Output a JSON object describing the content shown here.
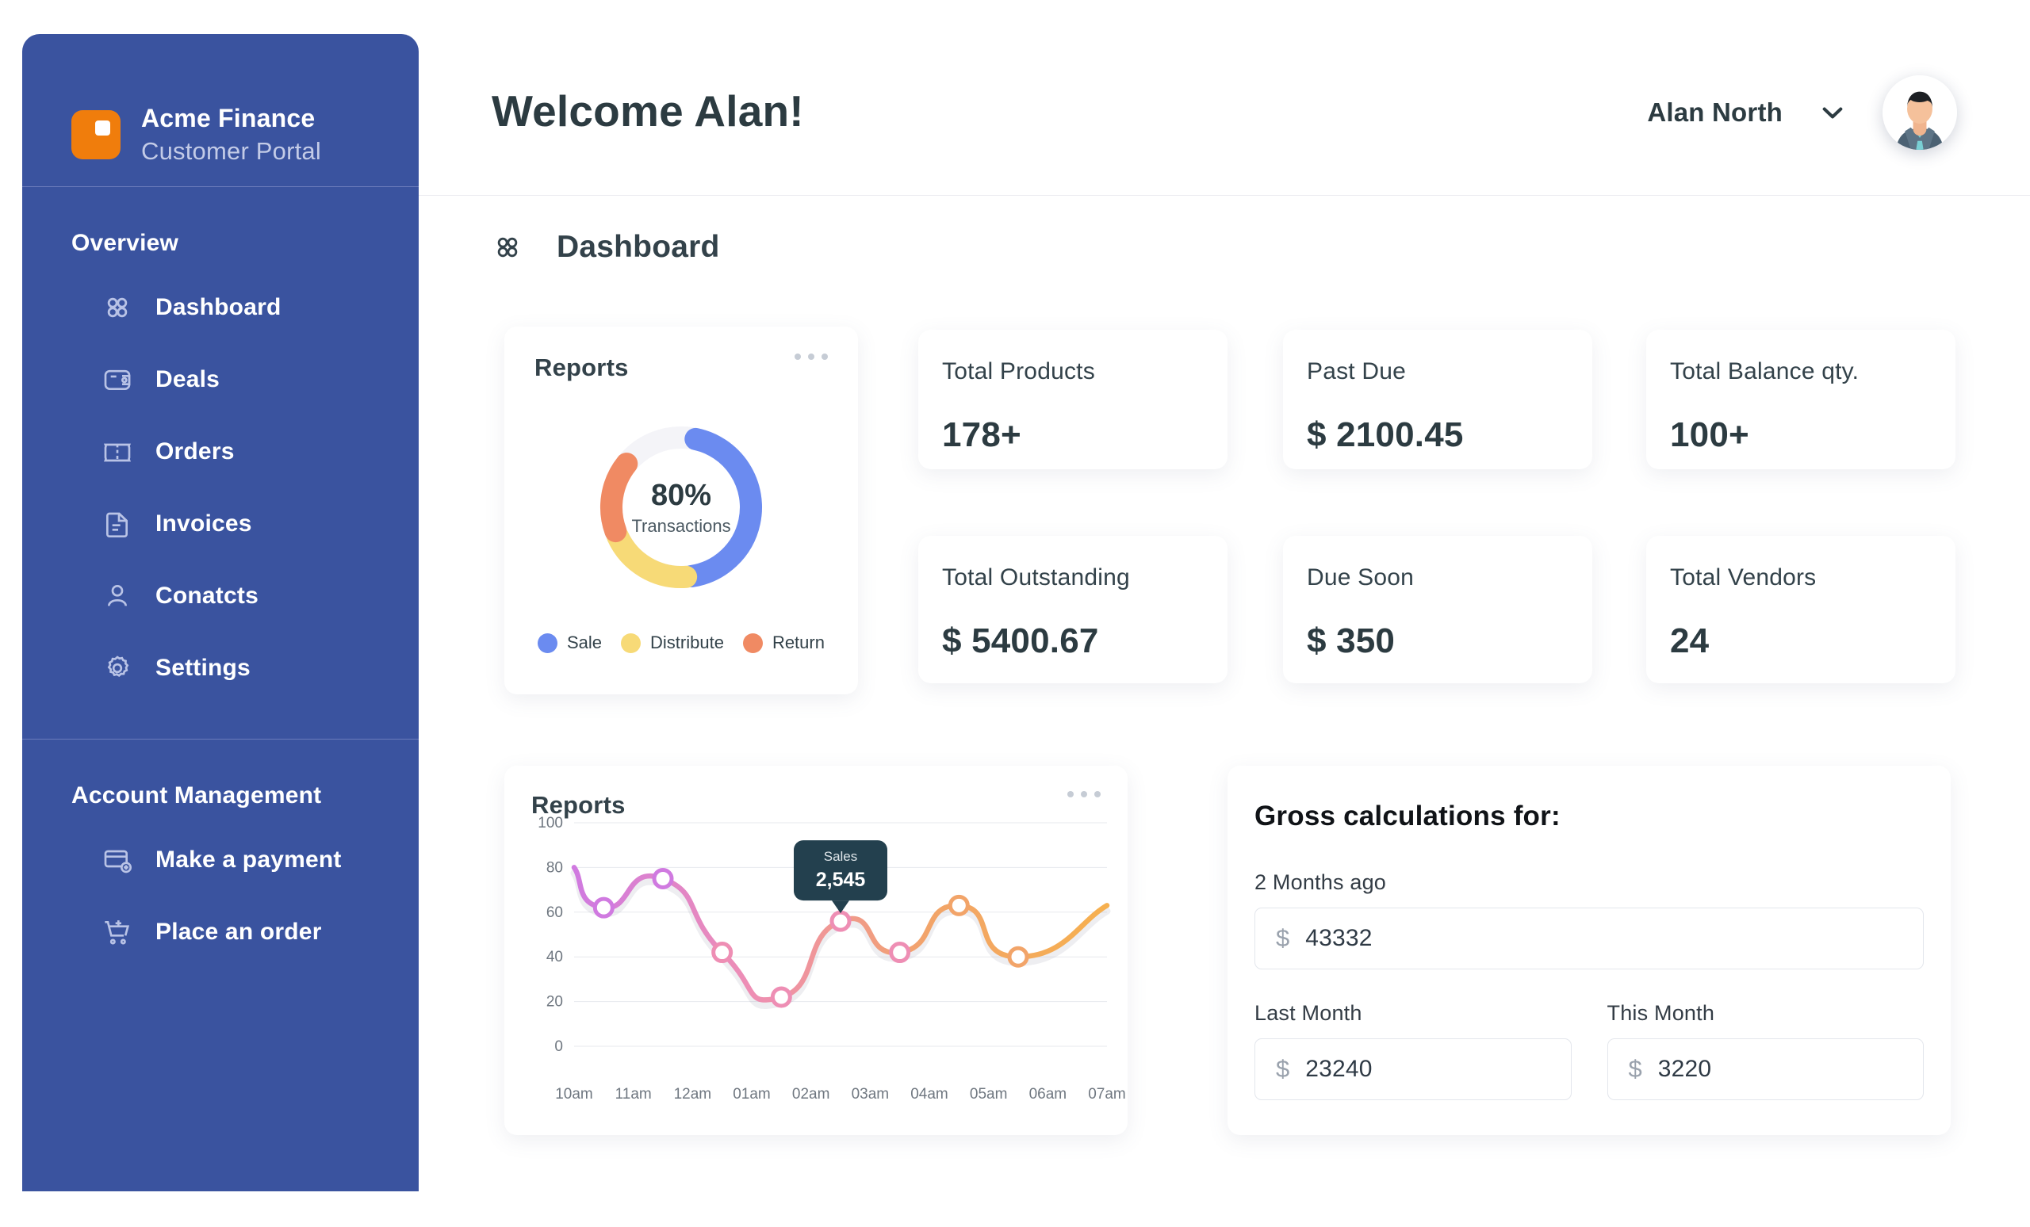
{
  "brand": {
    "name": "Acme Finance",
    "subtitle": "Customer Portal",
    "logo_color": "#f07d0c",
    "sidebar_color": "#3a539f"
  },
  "sidebar": {
    "sections": [
      {
        "heading": "Overview",
        "items": [
          {
            "label": "Dashboard",
            "icon": "grid-icon"
          },
          {
            "label": "Deals",
            "icon": "wallet-icon"
          },
          {
            "label": "Orders",
            "icon": "ticket-icon"
          },
          {
            "label": "Invoices",
            "icon": "document-icon"
          },
          {
            "label": "Conatcts",
            "icon": "user-icon"
          },
          {
            "label": "Settings",
            "icon": "gear-icon"
          }
        ]
      },
      {
        "heading": "Account Management",
        "items": [
          {
            "label": "Make a payment",
            "icon": "card-plus-icon"
          },
          {
            "label": "Place an order",
            "icon": "cart-plus-icon"
          }
        ]
      }
    ]
  },
  "header": {
    "welcome": "Welcome Alan!",
    "user_name": "Alan North",
    "chevron_icon": "chevron-down-icon",
    "avatar_icon": "avatar"
  },
  "page": {
    "title": "Dashboard",
    "icon": "grid-icon"
  },
  "donut_card": {
    "title": "Reports",
    "menu_icon": "more-horizontal-icon",
    "center_value": "80%",
    "center_label": "Transactions"
  },
  "stats": [
    {
      "label": "Total Products",
      "value": "178+"
    },
    {
      "label": "Past Due",
      "value": "$ 2100.45"
    },
    {
      "label": "Total Balance qty.",
      "value": "100+"
    },
    {
      "label": "Total Outstanding",
      "value": "$ 5400.67"
    },
    {
      "label": "Due Soon",
      "value": "$ 350"
    },
    {
      "label": "Total Vendors",
      "value": "24"
    }
  ],
  "line_card": {
    "title": "Reports",
    "menu_icon": "more-horizontal-icon"
  },
  "gross": {
    "title": "Gross calculations for:",
    "fields": [
      {
        "label": "2 Months ago",
        "currency": "$",
        "value": "43332"
      },
      {
        "label": "Last Month",
        "currency": "$",
        "value": "23240"
      },
      {
        "label": "This Month",
        "currency": "$",
        "value": "3220"
      }
    ]
  },
  "chart_data": [
    {
      "type": "pie",
      "title": "Reports",
      "subtype": "donut",
      "center_value": "80%",
      "center_label": "Transactions",
      "legend_position": "bottom",
      "labels": [
        "Sale",
        "Distribute",
        "Return"
      ],
      "values": [
        45,
        20,
        17
      ],
      "gap": 18,
      "colors": [
        "#6b8bf0",
        "#f7da77",
        "#f08a63"
      ],
      "track_color": "#f4f4f8"
    },
    {
      "type": "line",
      "title": "Reports",
      "xlabel": "",
      "ylabel": "",
      "ylim": [
        0,
        100
      ],
      "yticks": [
        0,
        20,
        40,
        60,
        80,
        100
      ],
      "grid": true,
      "x_tick_labels": [
        "10am",
        "11am",
        "12am",
        "01am",
        "02am",
        "03am",
        "04am",
        "05am",
        "06am",
        "07am"
      ],
      "series": [
        {
          "name": "Sales",
          "marker_x": [
            0.5,
            1.5,
            2.5,
            3.5,
            4.5,
            5.5,
            6.5,
            7.5
          ],
          "marker_y": [
            62,
            75,
            42,
            22,
            56,
            42,
            63,
            40
          ],
          "start_y": 80,
          "end_y": 63,
          "line_gradient": [
            "#d07ae0",
            "#ee8eb4",
            "#f2a469",
            "#f6b04f"
          ],
          "marker_fill": "#ffffff"
        }
      ],
      "tooltip": {
        "label": "Sales",
        "value": "2,545",
        "at_x": 4.5,
        "at_y": 56,
        "bg": "#23404e"
      }
    }
  ]
}
